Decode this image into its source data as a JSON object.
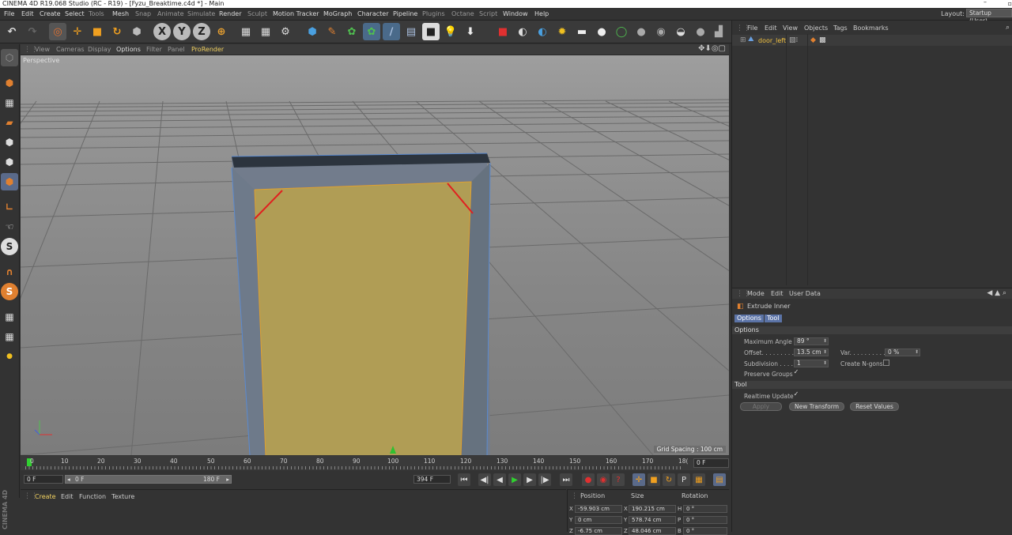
{
  "window": {
    "title": "CINEMA 4D R19.068 Studio (RC - R19) - [Fyzu_Breaktime.c4d *] - Main",
    "minimize": "–"
  },
  "menu": [
    "File",
    "Edit",
    "Create",
    "Select",
    "Tools",
    "Mesh",
    "Snap",
    "Animate",
    "Simulate",
    "Render",
    "Sculpt",
    "Motion Tracker",
    "MoGraph",
    "Character",
    "Pipeline",
    "Plugins",
    "Octane",
    "Script",
    "Window",
    "Help"
  ],
  "layout": {
    "label": "Layout:",
    "value": "Startup (User)"
  },
  "viewport": {
    "menu": [
      "View",
      "Cameras",
      "Display",
      "Options",
      "Filter",
      "Panel",
      "ProRender"
    ],
    "label": "Perspective",
    "grid_spacing": "Grid Spacing : 100 cm"
  },
  "object_manager": {
    "menu": [
      "File",
      "Edit",
      "View",
      "Objects",
      "Tags",
      "Bookmarks"
    ],
    "object": "door_left"
  },
  "attributes": {
    "menu": [
      "Mode",
      "Edit",
      "User Data"
    ],
    "tool_name": "Extrude Inner",
    "tabs": [
      "Options",
      "Tool"
    ],
    "section_options": "Options",
    "section_tool": "Tool",
    "max_angle_label": "Maximum Angle",
    "max_angle_value": "89 °",
    "offset_label": "Offset. . . . . . . . .",
    "offset_value": "13.5 cm",
    "var_label": "Var. . . . . . . . . .",
    "var_value": "0 %",
    "subdivision_label": "Subdivision . . . .",
    "subdivision_value": "1",
    "ngons_label": "Create N-gons",
    "preserve_label": "Preserve Groups",
    "realtime_label": "Realtime Update",
    "apply": "Apply",
    "new_transform": "New Transform",
    "reset_values": "Reset Values"
  },
  "timeline": {
    "ticks": [
      "0",
      "10",
      "20",
      "30",
      "40",
      "50",
      "60",
      "70",
      "80",
      "90",
      "100",
      "110",
      "120",
      "130",
      "140",
      "150",
      "160",
      "170",
      "18("
    ],
    "current_frame": "0 F",
    "start_field": "0 F",
    "slider_start": "0 F",
    "slider_end": "180 F",
    "end_field": "394 F"
  },
  "material_manager": {
    "menu": [
      "Create",
      "Edit",
      "Function",
      "Texture"
    ]
  },
  "coordinates": {
    "headers": [
      "Position",
      "Size",
      "Rotation"
    ],
    "rows": [
      {
        "axis": "X",
        "pos": "-59.903 cm",
        "size_axis": "X",
        "size": "190.215 cm",
        "rot_axis": "H",
        "rot": "0 °"
      },
      {
        "axis": "Y",
        "pos": "0 cm",
        "size_axis": "Y",
        "size": "578.74 cm",
        "rot_axis": "P",
        "rot": "0 °"
      },
      {
        "axis": "Z",
        "pos": "-6.75 cm",
        "size_axis": "Z",
        "size": "48.046 cm",
        "rot_axis": "B",
        "rot": "0 °"
      }
    ]
  },
  "brand": "CINEMA 4D",
  "colors": {
    "accent": "#5b73a6",
    "selection_face": "#b5a050",
    "edge_red": "#e02020",
    "panel_bg": "#333333"
  }
}
